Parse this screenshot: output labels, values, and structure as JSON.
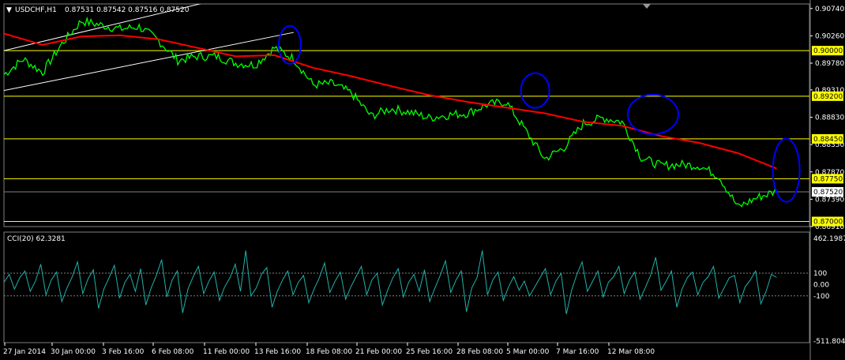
{
  "header": {
    "menu_icon": "triangle-down-icon",
    "symbol": "USDCHF,H1",
    "quote": "0.87531 0.87542 0.87516 0.87520"
  },
  "colors": {
    "background": "#000000",
    "price": "#00ff00",
    "moving_average": "#ff0000",
    "levels": "#ffff00",
    "channel": "#ffffff",
    "circles": "#0000ff",
    "cci": "#20b2aa",
    "grid": "#808080"
  },
  "chart_data": [
    {
      "type": "line",
      "symbol": "USDCHF",
      "timeframe": "H1",
      "ylim": [
        0.8691,
        0.9082
      ],
      "y_ticks": [
        "0.90740",
        "0.90260",
        "0.89780",
        "0.89310",
        "0.88830",
        "0.88350",
        "0.87870",
        "0.87390",
        "0.86910"
      ],
      "x_ticks": [
        "27 Jan 2014",
        "30 Jan 00:00",
        "3 Feb 16:00",
        "6 Feb 08:00",
        "11 Feb 00:00",
        "13 Feb 16:00",
        "18 Feb 08:00",
        "21 Feb 00:00",
        "25 Feb 16:00",
        "28 Feb 08:00",
        "5 Mar 00:00",
        "7 Mar 16:00",
        "12 Mar 08:00"
      ],
      "series": [
        {
          "kind": "price",
          "x": [
            0,
            10,
            20,
            30,
            40,
            50,
            60,
            70,
            80,
            90,
            100,
            110,
            120,
            130,
            140,
            150,
            160,
            170,
            180,
            190,
            200,
            210,
            220,
            230,
            240,
            250,
            260,
            270,
            280,
            290,
            300,
            310,
            320,
            330,
            340,
            350,
            360,
            370,
            380,
            390,
            400
          ],
          "values": [
            0.8958,
            0.8985,
            0.8962,
            0.9012,
            0.9052,
            0.9045,
            0.9038,
            0.9042,
            0.9018,
            0.8983,
            0.899,
            0.899,
            0.8978,
            0.8975,
            0.9005,
            0.8986,
            0.894,
            0.8942,
            0.8925,
            0.8885,
            0.8898,
            0.8892,
            0.8882,
            0.8887,
            0.889,
            0.8905,
            0.891,
            0.886,
            0.881,
            0.883,
            0.8872,
            0.8882,
            0.8875,
            0.8812,
            0.8798,
            0.88,
            0.8798,
            0.878,
            0.8725,
            0.8742,
            0.8753
          ]
        },
        {
          "kind": "moving_average",
          "x": [
            0,
            20,
            40,
            60,
            80,
            100,
            120,
            140,
            160,
            180,
            200,
            220,
            240,
            260,
            280,
            300,
            320,
            340,
            360,
            380,
            400
          ],
          "values": [
            0.903,
            0.901,
            0.9025,
            0.9027,
            0.902,
            0.9005,
            0.899,
            0.8992,
            0.897,
            0.8955,
            0.8938,
            0.8922,
            0.891,
            0.89,
            0.889,
            0.8875,
            0.8868,
            0.885,
            0.8838,
            0.882,
            0.8793
          ]
        }
      ],
      "level_labels": [
        "0.90000",
        "0.89200",
        "0.88450",
        "0.87750",
        "0.87000"
      ],
      "current_price": "0.87520",
      "channel_lines": [
        {
          "x": [
            0,
            225
          ],
          "values": [
            0.9,
            0.9182
          ]
        },
        {
          "x": [
            0,
            150
          ],
          "values": [
            0.893,
            0.9032
          ]
        }
      ],
      "highlight_ellipses": [
        {
          "x": 148,
          "y": 0.901
        },
        {
          "x": 275,
          "y": 0.893
        },
        {
          "x": 336,
          "y": 0.8888
        },
        {
          "x": 405,
          "y": 0.879
        }
      ]
    },
    {
      "type": "line",
      "indicator": "CCI(20)",
      "value_label": "CCI(20) 62.3281",
      "current_value": 62.3281,
      "ylim": [
        -511.8047,
        462.1987
      ],
      "y_ticks": [
        "462.1987",
        "100",
        "0.00",
        "-100",
        "-511.8047"
      ],
      "reference_levels": [
        100,
        -100
      ],
      "x_start": 0,
      "x_end": 400,
      "points": [
        20,
        90,
        -40,
        60,
        120,
        -60,
        30,
        180,
        -90,
        40,
        110,
        -150,
        -30,
        70,
        200,
        -80,
        50,
        130,
        -210,
        -40,
        60,
        170,
        -120,
        20,
        90,
        -60,
        140,
        -180,
        -30,
        80,
        220,
        -110,
        40,
        120,
        -250,
        -40,
        70,
        160,
        -80,
        30,
        110,
        -140,
        -20,
        60,
        180,
        -60,
        300,
        -100,
        -30,
        90,
        150,
        -200,
        -60,
        40,
        120,
        -90,
        20,
        80,
        -160,
        -40,
        60,
        190,
        -70,
        30,
        110,
        -130,
        -20,
        70,
        160,
        -90,
        40,
        100,
        -180,
        -50,
        60,
        140,
        -110,
        20,
        90,
        -60,
        130,
        -150,
        -30,
        80,
        210,
        -70,
        40,
        120,
        -240,
        -30,
        60,
        300,
        -90,
        40,
        110,
        -140,
        -20,
        70,
        -50,
        30,
        -100,
        -20,
        60,
        140,
        -90,
        30,
        100,
        -260,
        -50,
        90,
        200,
        -60,
        30,
        120,
        -110,
        20,
        70,
        160,
        -80,
        40,
        110,
        -130,
        -30,
        80,
        240,
        -50,
        30,
        120,
        -200,
        -40,
        60,
        110,
        -90,
        20,
        70,
        160,
        -120,
        -30,
        60,
        80,
        -160,
        -20,
        40,
        120,
        -170,
        -60,
        90,
        62
      ]
    }
  ]
}
